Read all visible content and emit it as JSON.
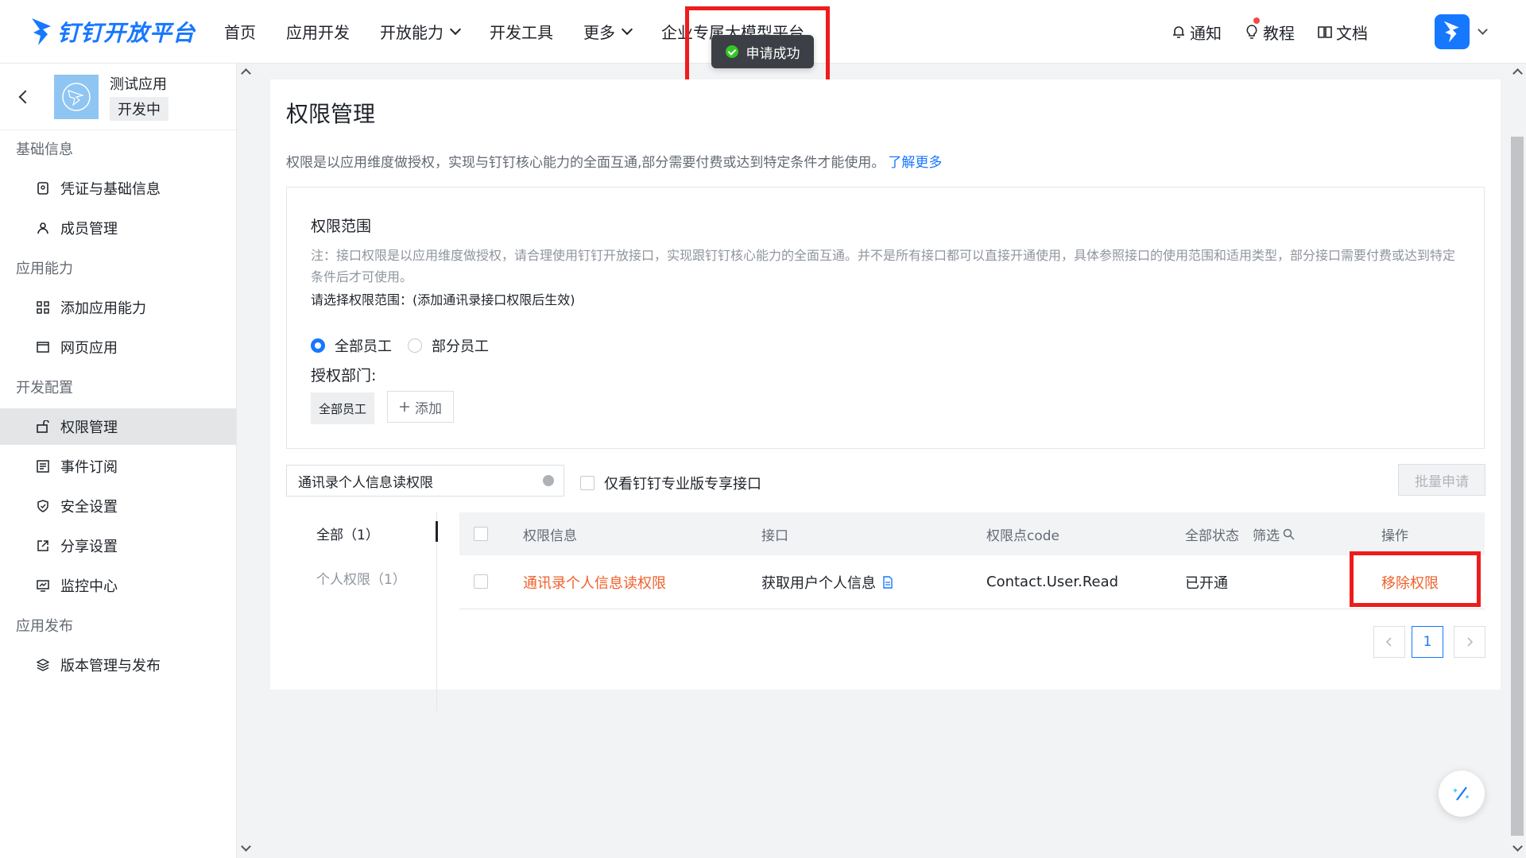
{
  "brand": {
    "name": "钉钉开放平台",
    "color": "#1677ff"
  },
  "nav": {
    "items": [
      {
        "label": "首页",
        "dropdown": false
      },
      {
        "label": "应用开发",
        "dropdown": false
      },
      {
        "label": "开放能力",
        "dropdown": true
      },
      {
        "label": "开发工具",
        "dropdown": false
      },
      {
        "label": "更多",
        "dropdown": true
      },
      {
        "label": "企业专属大模型平台",
        "dropdown": false
      }
    ],
    "right": {
      "notify": "通知",
      "tutorial": "教程",
      "docs": "文档"
    }
  },
  "toast": {
    "text": "申请成功",
    "icon": "success-check-icon"
  },
  "sidebar": {
    "app_name": "测试应用",
    "app_status": "开发中",
    "groups": [
      {
        "title": "基础信息",
        "items": [
          {
            "label": "凭证与基础信息",
            "icon": "credential-icon"
          },
          {
            "label": "成员管理",
            "icon": "user-icon"
          }
        ]
      },
      {
        "title": "应用能力",
        "items": [
          {
            "label": "添加应用能力",
            "icon": "apps-icon"
          },
          {
            "label": "网页应用",
            "icon": "webpage-icon"
          }
        ]
      },
      {
        "title": "开发配置",
        "items": [
          {
            "label": "权限管理",
            "icon": "permission-icon"
          },
          {
            "label": "事件订阅",
            "icon": "event-icon"
          },
          {
            "label": "安全设置",
            "icon": "shield-icon"
          },
          {
            "label": "分享设置",
            "icon": "share-icon"
          },
          {
            "label": "监控中心",
            "icon": "monitor-icon"
          }
        ]
      },
      {
        "title": "应用发布",
        "items": [
          {
            "label": "版本管理与发布",
            "icon": "layers-icon"
          }
        ]
      }
    ]
  },
  "main": {
    "title": "权限管理",
    "description": "权限是以应用维度做授权，实现与钉钉核心能力的全面互通,部分需要付费或达到特定条件才能使用。",
    "learn_more": "了解更多",
    "scope": {
      "title": "权限范围",
      "note": "注：接口权限是以应用维度做授权，请合理使用钉钉开放接口，实现跟钉钉核心能力的全面互通。并不是所有接口都可以直接开通使用，具体参照接口的使用范围和适用类型，部分接口需要付费或达到特定条件后才可使用。",
      "choose_label": "请选择权限范围：(添加通讯录接口权限后生效)",
      "radio_all": "全部员工",
      "radio_part": "部分员工",
      "selected": "全部员工",
      "dept_label": "授权部门:",
      "dept_tag": "全部员工",
      "add_btn": "添加"
    },
    "search_value": "通讯录个人信息读权限",
    "filter_label": "仅看钉钉专业版专享接口",
    "batch_btn": "批量申请",
    "tabs": [
      {
        "label": "全部（1）",
        "active": true
      },
      {
        "label": "个人权限（1）",
        "active": false
      }
    ],
    "table": {
      "headers": {
        "info": "权限信息",
        "api": "接口",
        "code": "权限点code",
        "status": "全部状态",
        "filter": "筛选",
        "action": "操作"
      },
      "rows": [
        {
          "info": "通讯录个人信息读权限",
          "api": "获取用户个人信息",
          "code": "Contact.User.Read",
          "status": "已开通",
          "action": "移除权限"
        }
      ]
    },
    "pagination": {
      "current": "1"
    }
  }
}
